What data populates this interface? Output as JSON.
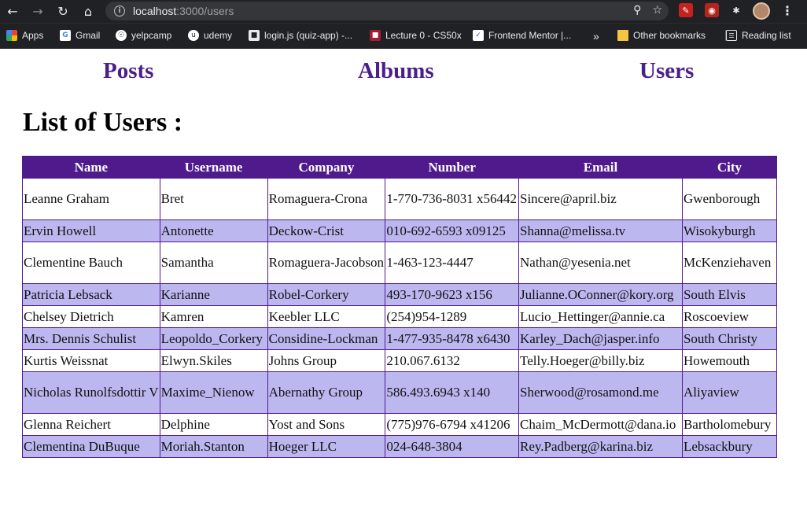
{
  "browser": {
    "url_host": "localhost",
    "url_rest": ":3000/users",
    "bookmarks": [
      {
        "label": "Apps",
        "icon": "apps-grid-icon",
        "color": "#e8453c"
      },
      {
        "label": "Gmail",
        "icon": "google-icon",
        "color": "#ffffff"
      },
      {
        "label": "yelpcamp",
        "icon": "globe-icon",
        "color": "#ffffff"
      },
      {
        "label": "udemy",
        "icon": "udemy-icon",
        "color": "#ffffff"
      },
      {
        "label": "login.js (quiz-app) -...",
        "icon": "page-icon",
        "color": "#ffffff"
      },
      {
        "label": "Lecture 0 - CS50x",
        "icon": "harvard-icon",
        "color": "#a51c30"
      },
      {
        "label": "Frontend Mentor |...",
        "icon": "frontend-mentor-icon",
        "color": "#ffffff"
      },
      {
        "label": "Other bookmarks",
        "icon": "folder-icon",
        "color": "#f4c542"
      },
      {
        "label": "Reading list",
        "icon": "reading-list-icon",
        "color": "#ffffff"
      }
    ],
    "more_label": "»"
  },
  "nav": {
    "posts": "Posts",
    "albums": "Albums",
    "users": "Users"
  },
  "page": {
    "heading": "List of Users :"
  },
  "table": {
    "columns": [
      "Name",
      "Username",
      "Company",
      "Number",
      "Email",
      "City"
    ],
    "rows": [
      {
        "name": "Leanne Graham",
        "username": "Bret",
        "company": "Romaguera-Crona",
        "number": "1-770-736-8031 x56442",
        "email": "Sincere@april.biz",
        "city": "Gwenborough"
      },
      {
        "name": "Ervin Howell",
        "username": "Antonette",
        "company": "Deckow-Crist",
        "number": "010-692-6593 x09125",
        "email": "Shanna@melissa.tv",
        "city": "Wisokyburgh"
      },
      {
        "name": "Clementine Bauch",
        "username": "Samantha",
        "company": "Romaguera-Jacobson",
        "number": "1-463-123-4447",
        "email": "Nathan@yesenia.net",
        "city": "McKenziehaven"
      },
      {
        "name": "Patricia Lebsack",
        "username": "Karianne",
        "company": "Robel-Corkery",
        "number": "493-170-9623 x156",
        "email": "Julianne.OConner@kory.org",
        "city": "South Elvis"
      },
      {
        "name": "Chelsey Dietrich",
        "username": "Kamren",
        "company": "Keebler LLC",
        "number": "(254)954-1289",
        "email": "Lucio_Hettinger@annie.ca",
        "city": "Roscoeview"
      },
      {
        "name": "Mrs. Dennis Schulist",
        "username": "Leopoldo_Corkery",
        "company": "Considine-Lockman",
        "number": "1-477-935-8478 x6430",
        "email": "Karley_Dach@jasper.info",
        "city": "South Christy"
      },
      {
        "name": "Kurtis Weissnat",
        "username": "Elwyn.Skiles",
        "company": "Johns Group",
        "number": "210.067.6132",
        "email": "Telly.Hoeger@billy.biz",
        "city": "Howemouth"
      },
      {
        "name": "Nicholas Runolfsdottir V",
        "username": "Maxime_Nienow",
        "company": "Abernathy Group",
        "number": "586.493.6943 x140",
        "email": "Sherwood@rosamond.me",
        "city": "Aliyaview"
      },
      {
        "name": "Glenna Reichert",
        "username": "Delphine",
        "company": "Yost and Sons",
        "number": "(775)976-6794 x41206",
        "email": "Chaim_McDermott@dana.io",
        "city": "Bartholomebury"
      },
      {
        "name": "Clementina DuBuque",
        "username": "Moriah.Stanton",
        "company": "Hoeger LLC",
        "number": "024-648-3804",
        "email": "Rey.Padberg@karina.biz",
        "city": "Lebsackbury"
      }
    ]
  },
  "colors": {
    "header_bg": "#4f1a8c",
    "stripe": "#bdb7f0",
    "nav_link": "#4a1f8a"
  }
}
